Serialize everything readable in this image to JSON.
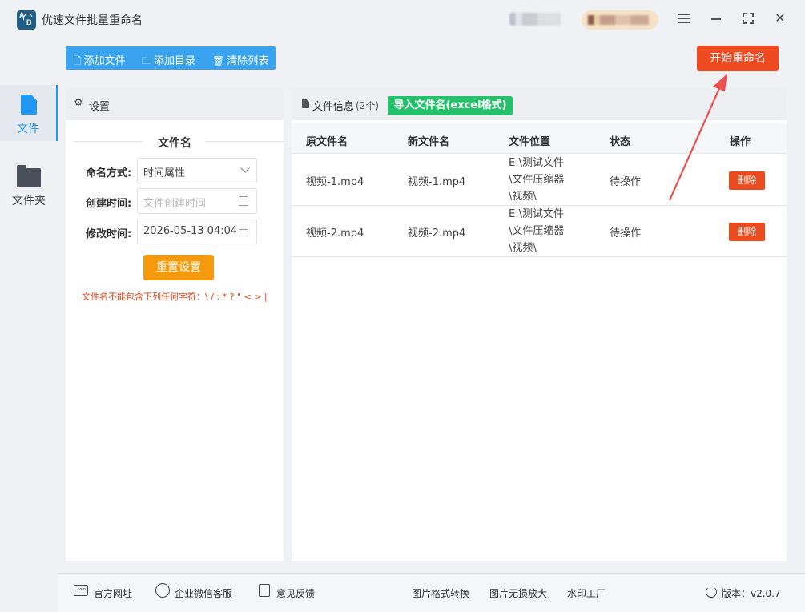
{
  "app": {
    "title": "优速文件批量重命名"
  },
  "nav": {
    "items": [
      {
        "label": "文件",
        "icon": "file-icon",
        "active": true
      },
      {
        "label": "文件夹",
        "icon": "folder-icon",
        "active": false
      }
    ]
  },
  "toolbar": {
    "add_file": "添加文件",
    "add_dir": "添加目录",
    "clear_list": "清除列表",
    "start_rename": "开始重命名"
  },
  "settings": {
    "title": "设置",
    "section_title": "文件名",
    "naming_mode_label": "命名方式:",
    "naming_mode_value": "时间属性",
    "created_label": "创建时间:",
    "created_placeholder": "文件创建时间",
    "modified_label": "修改时间:",
    "modified_value": "2026-05-13 04:04",
    "reset_button": "重置设置",
    "warning": "文件名不能包含下列任何字符：\\ / : * ? \" < > |"
  },
  "file_info": {
    "title": "文件信息",
    "count": "(2个)",
    "import_button": "导入文件名(excel格式)",
    "columns": [
      "原文件名",
      "新文件名",
      "文件位置",
      "状态",
      "操作"
    ],
    "rows": [
      {
        "original": "视频-1.mp4",
        "new": "视频-1.mp4",
        "location": [
          "E:\\测试文件",
          "\\文件压缩器",
          "\\视频\\"
        ],
        "status": "待操作",
        "action": "删除"
      },
      {
        "original": "视频-2.mp4",
        "new": "视频-2.mp4",
        "location": [
          "E:\\测试文件",
          "\\文件压缩器",
          "\\视频\\"
        ],
        "status": "待操作",
        "action": "删除"
      }
    ]
  },
  "footer": {
    "website": "官方网址",
    "wechat_support": "企业微信客服",
    "feedback": "意见反馈",
    "image_convert": "图片格式转换",
    "image_upscale": "图片无损放大",
    "watermark": "水印工厂",
    "version": "版本：v2.0.7"
  },
  "colors": {
    "primary_blue": "#3aa3f0",
    "start_red": "#ee4a20",
    "reset_orange": "#f59a0c",
    "import_green": "#25c06a",
    "delete_red": "#e94a1e"
  }
}
